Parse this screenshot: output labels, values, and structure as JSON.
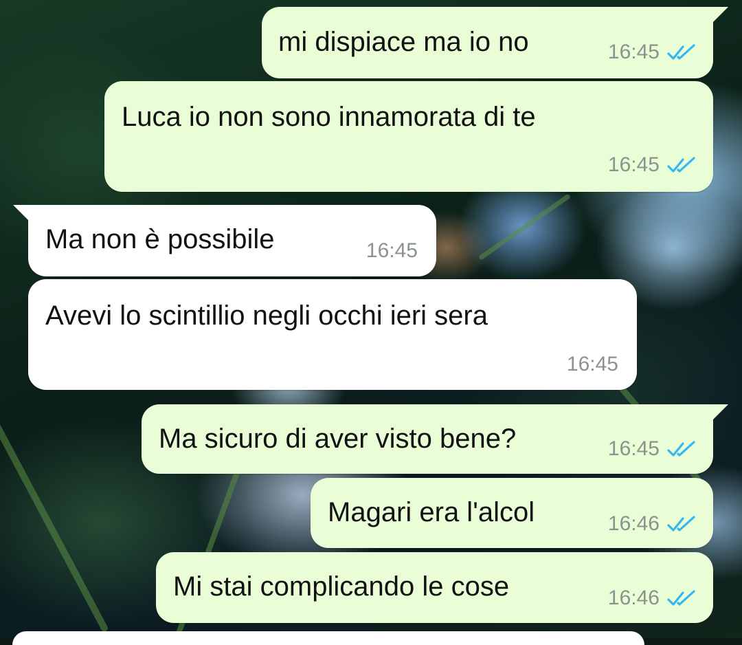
{
  "chat": {
    "messages": [
      {
        "direction": "outgoing",
        "text": "mi dispiace ma io no",
        "time": "16:45",
        "status": "read-double-check"
      },
      {
        "direction": "outgoing",
        "text": "Luca io non sono innamorata di te",
        "time": "16:45",
        "status": "read-double-check"
      },
      {
        "direction": "incoming",
        "text": "Ma non è possibile",
        "time": "16:45"
      },
      {
        "direction": "incoming",
        "text": "Avevi lo scintillio negli occhi ieri sera",
        "time": "16:45"
      },
      {
        "direction": "outgoing",
        "text": "Ma sicuro di aver visto bene?",
        "time": "16:45",
        "status": "read-double-check"
      },
      {
        "direction": "outgoing",
        "text": "Magari era l'alcol",
        "time": "16:46",
        "status": "read-double-check"
      },
      {
        "direction": "outgoing",
        "text": "Mi stai complicando le cose",
        "time": "16:46",
        "status": "read-double-check"
      }
    ]
  },
  "colors": {
    "outgoing_bubble": "#e9fdd6",
    "incoming_bubble": "#ffffff",
    "read_ticks": "#34b7f1",
    "timestamp": "#8a938c"
  },
  "icons": {
    "read_status": "double-check-icon"
  }
}
